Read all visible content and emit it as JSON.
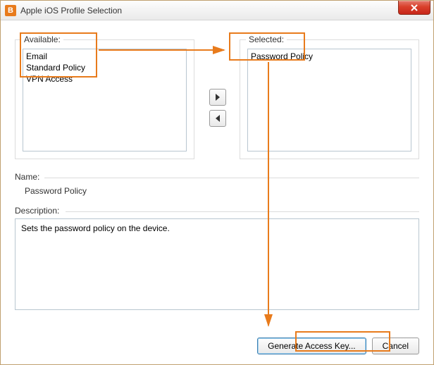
{
  "window": {
    "title": "Apple iOS Profile Selection",
    "app_icon_letter": "B"
  },
  "available": {
    "label": "Available:",
    "items": [
      "Email",
      "Standard Policy",
      "VPN Access"
    ]
  },
  "selected": {
    "label": "Selected:",
    "items": [
      "Password Policy"
    ]
  },
  "name": {
    "label": "Name:",
    "value": "Password Policy"
  },
  "description": {
    "label": "Description:",
    "value": "Sets the password policy on the device."
  },
  "buttons": {
    "generate": "Generate Access Key...",
    "cancel": "Cancel"
  },
  "annotation_color": "#e87b1c"
}
